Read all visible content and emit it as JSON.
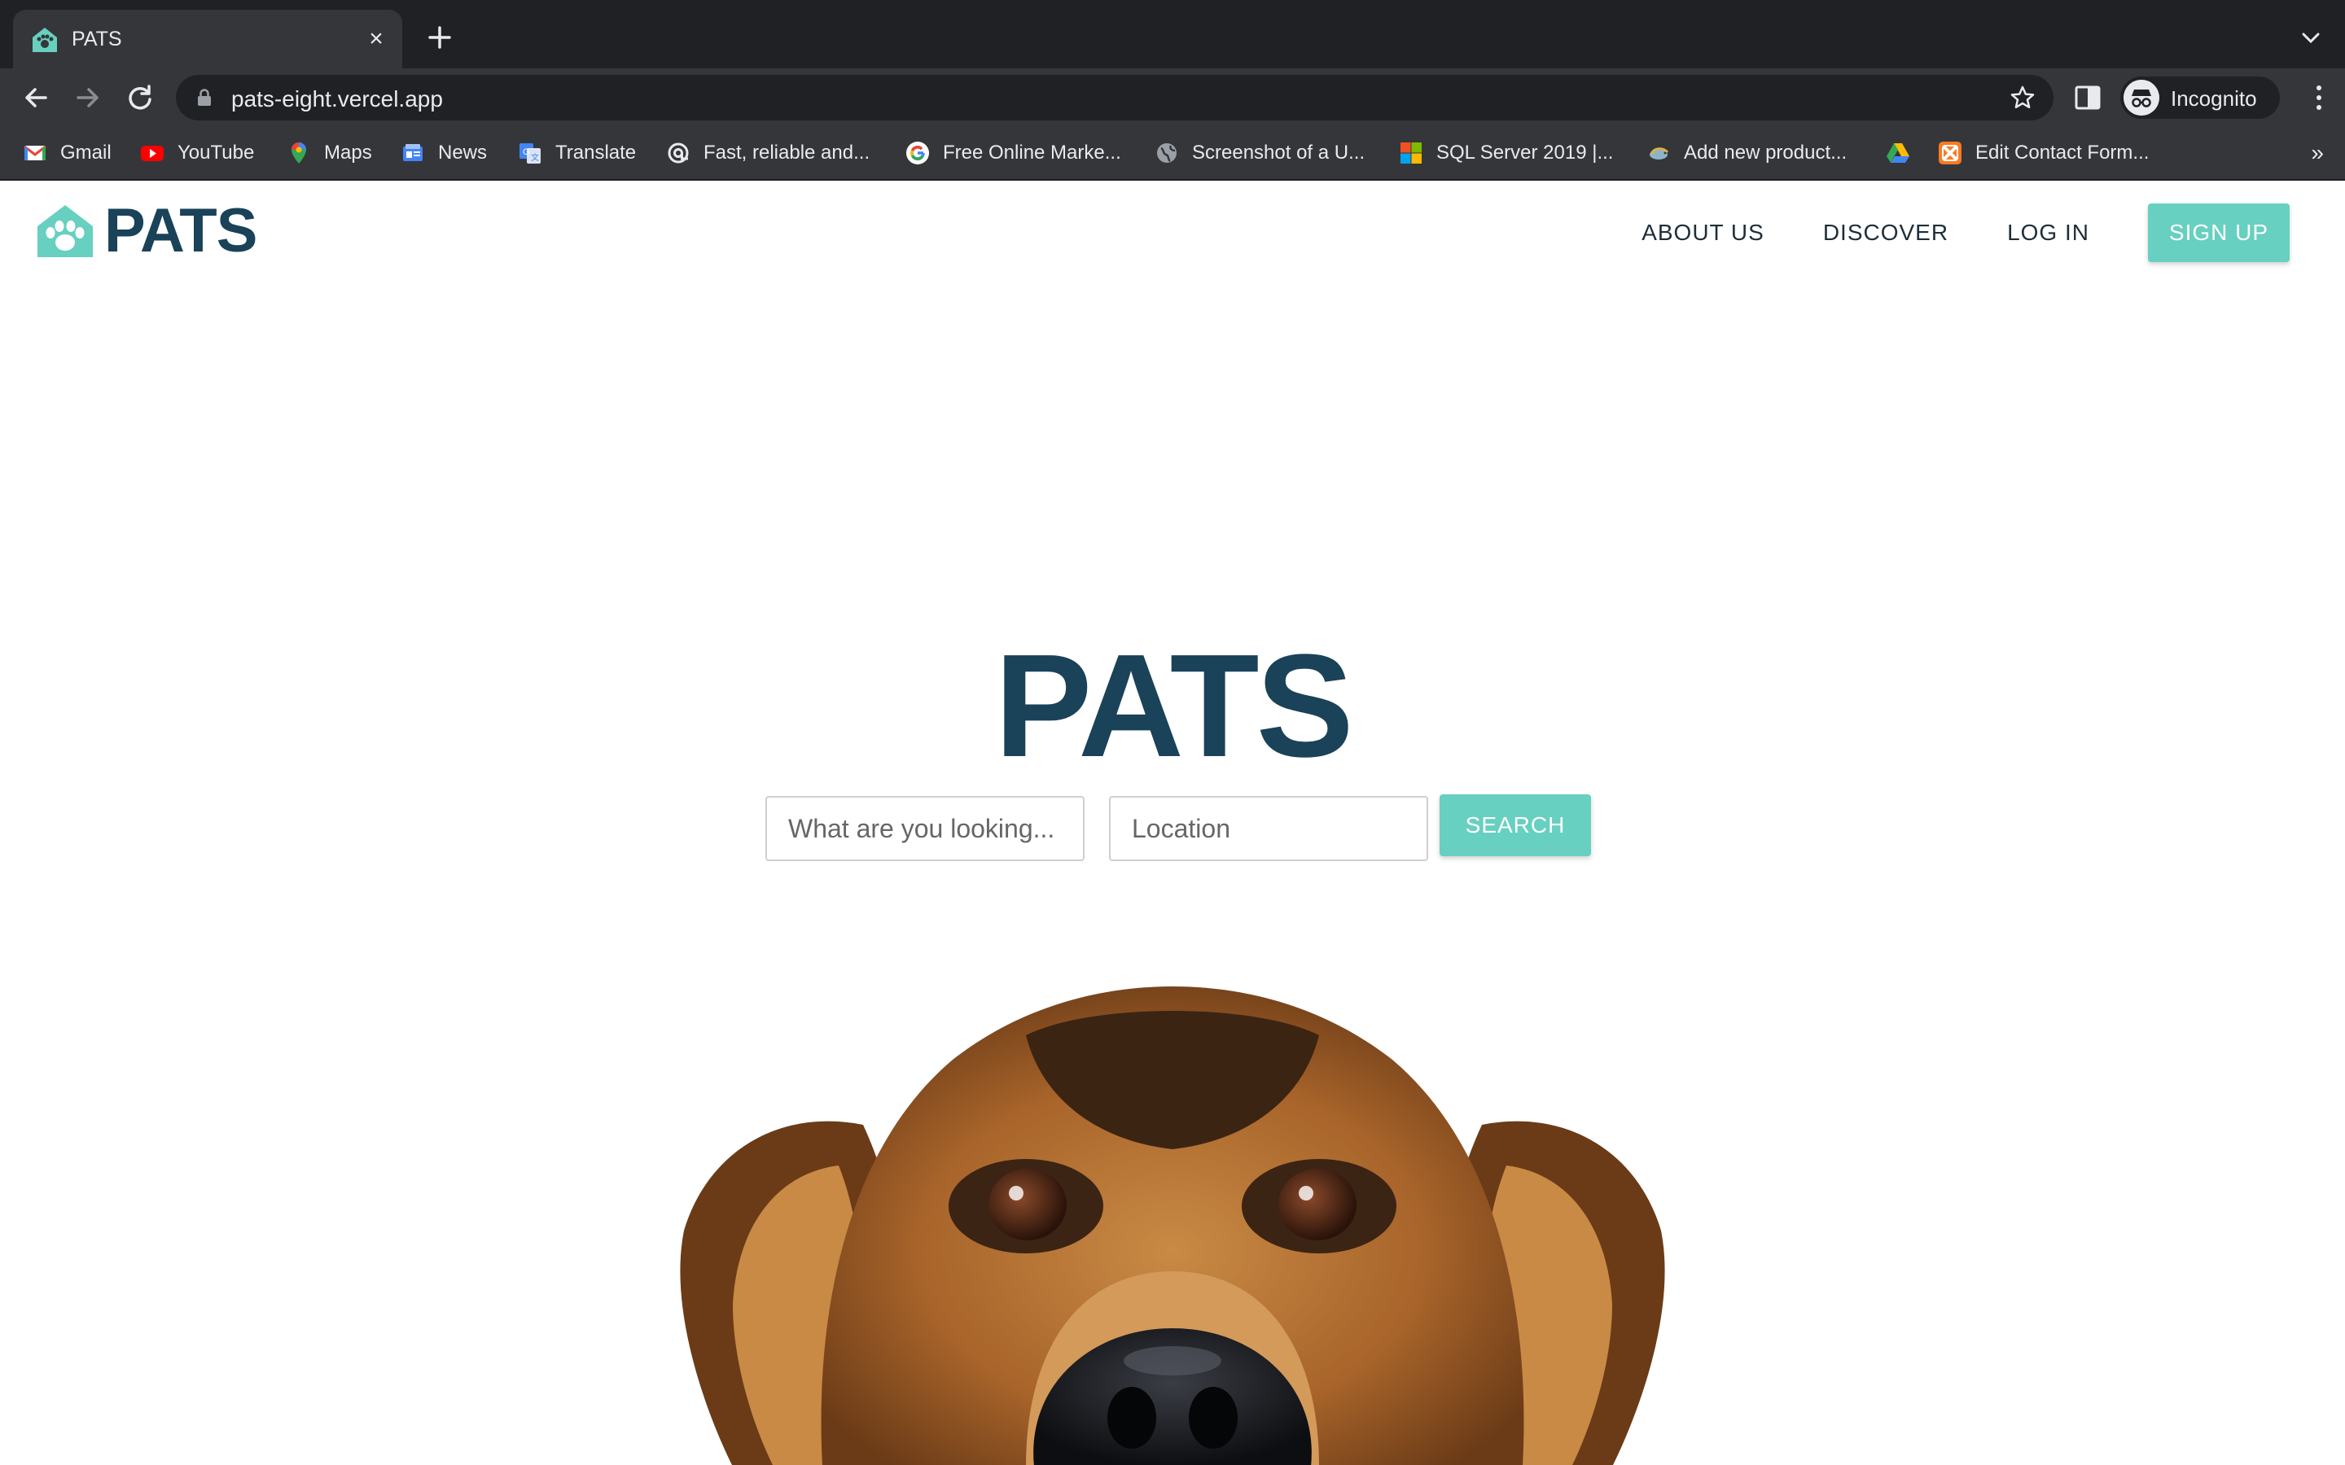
{
  "browser": {
    "tab": {
      "title": "PATS",
      "close_glyph": "×",
      "favicon": "pats-house-paw-icon"
    },
    "url": "pats-eight.vercel.app",
    "profile_label": "Incognito",
    "bookmarks": [
      {
        "label": "Gmail",
        "icon": "gmail-icon"
      },
      {
        "label": "YouTube",
        "icon": "youtube-icon"
      },
      {
        "label": "Maps",
        "icon": "maps-icon"
      },
      {
        "label": "News",
        "icon": "news-icon"
      },
      {
        "label": "Translate",
        "icon": "translate-icon"
      },
      {
        "label": "Fast, reliable and...",
        "icon": "at-sign-icon"
      },
      {
        "label": "Free Online Marke...",
        "icon": "google-icon"
      },
      {
        "label": "Screenshot of a U...",
        "icon": "globe-icon"
      },
      {
        "label": "SQL Server 2019 |...",
        "icon": "microsoft-icon"
      },
      {
        "label": "Add new product...",
        "icon": "bird-icon"
      },
      {
        "label": "",
        "icon": "google-drive-icon"
      },
      {
        "label": "Edit Contact Form...",
        "icon": "xampp-icon"
      }
    ],
    "bookmarks_overflow": "»"
  },
  "site": {
    "logo_text": "PATS",
    "nav": {
      "about": "ABOUT US",
      "discover": "DISCOVER",
      "login": "LOG IN",
      "signup": "SIGN UP"
    },
    "hero_title": "PATS",
    "search": {
      "what_placeholder": "What are you looking...",
      "location_placeholder": "Location",
      "button": "SEARCH"
    },
    "hero_image": "dog-peeking-photo"
  },
  "colors": {
    "brand_navy": "#1a4259",
    "brand_teal": "#67d0c0",
    "chrome_dark": "#202124",
    "chrome_toolbar": "#35363a"
  }
}
